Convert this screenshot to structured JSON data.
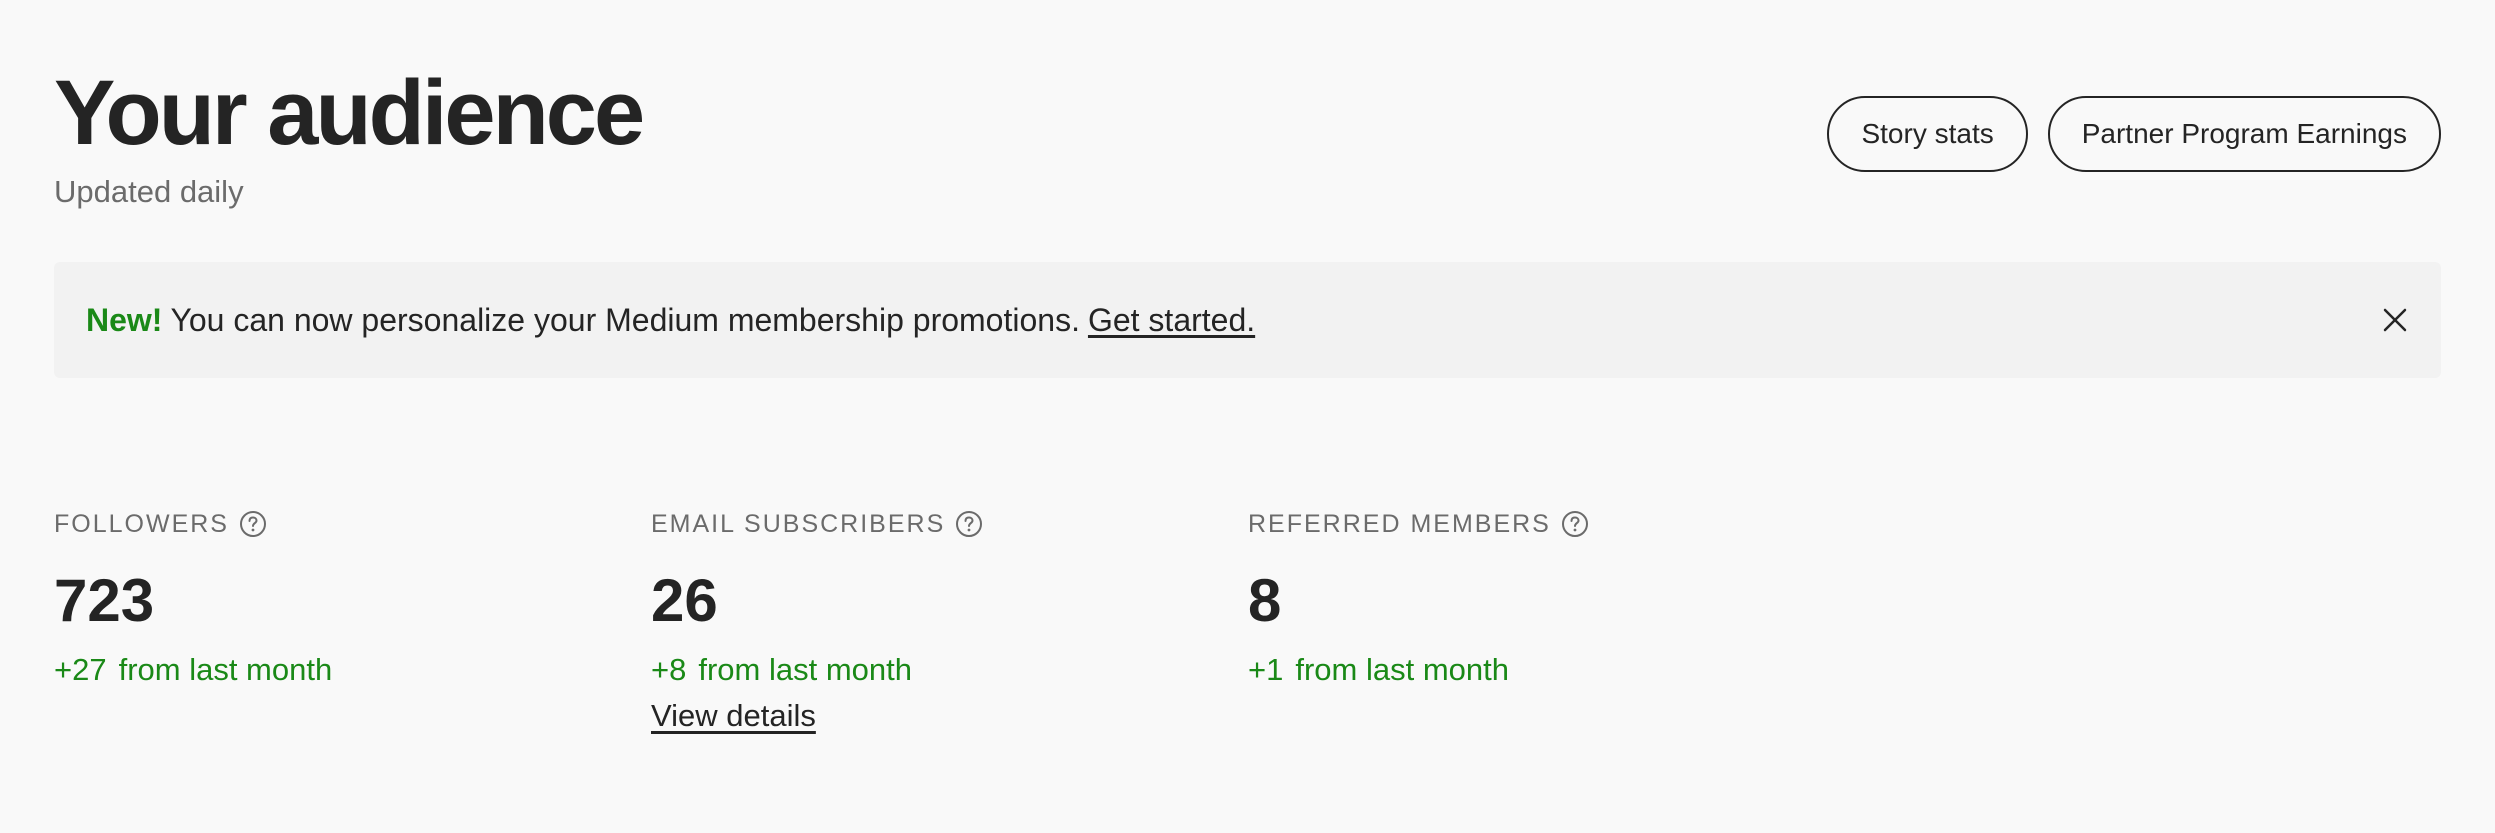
{
  "header": {
    "title": "Your audience",
    "subtitle": "Updated daily",
    "buttons": {
      "story_stats": "Story stats",
      "partner_program": "Partner Program Earnings"
    }
  },
  "banner": {
    "new_label": "New!",
    "message": "You can now personalize your Medium membership promotions.",
    "link": "Get started.",
    "close_icon": "close-icon"
  },
  "stats": {
    "followers": {
      "label": "FOLLOWERS",
      "value": "723",
      "delta": "+27",
      "delta_text": "from last month",
      "icon": "help-icon"
    },
    "email_subscribers": {
      "label": "EMAIL SUBSCRIBERS",
      "value": "26",
      "delta": "+8",
      "delta_text": "from last month",
      "link": "View details",
      "icon": "help-icon"
    },
    "referred_members": {
      "label": "REFERRED MEMBERS",
      "value": "8",
      "delta": "+1",
      "delta_text": "from last month",
      "icon": "help-icon"
    }
  },
  "colors": {
    "text": "#242424",
    "muted": "#6b6b6b",
    "accent_green": "#1a8917",
    "banner_bg": "#f2f2f2",
    "page_bg": "#f9f9f9"
  }
}
